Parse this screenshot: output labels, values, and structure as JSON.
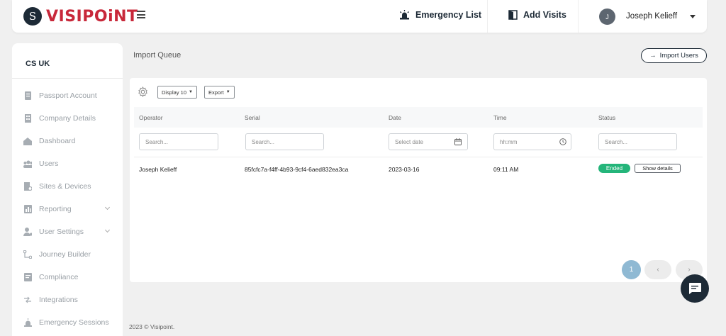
{
  "header": {
    "logo_text": "VISIPOiNT",
    "emergency_label": "Emergency List",
    "add_visits_label": "Add Visits",
    "user_initial": "J",
    "user_name": "Joseph Kelieff"
  },
  "sidebar": {
    "org": "CS UK",
    "items": [
      {
        "label": "Passport Account",
        "icon": "passport-icon"
      },
      {
        "label": "Company Details",
        "icon": "building-icon"
      },
      {
        "label": "Dashboard",
        "icon": "home-icon"
      },
      {
        "label": "Users",
        "icon": "users-icon"
      },
      {
        "label": "Sites & Devices",
        "icon": "sites-icon"
      },
      {
        "label": "Reporting",
        "icon": "reporting-icon"
      },
      {
        "label": "User Settings",
        "icon": "user-settings-icon"
      },
      {
        "label": "Journey Builder",
        "icon": "journey-icon"
      },
      {
        "label": "Compliance",
        "icon": "compliance-icon"
      },
      {
        "label": "Integrations",
        "icon": "integrations-icon"
      },
      {
        "label": "Emergency Sessions",
        "icon": "emergency-icon"
      }
    ]
  },
  "page": {
    "title": "Import Queue",
    "import_label": "Import Users"
  },
  "table": {
    "display_label": "Display 10",
    "export_label": "Export",
    "columns": [
      "Operator",
      "Serial",
      "Date",
      "Time",
      "Status"
    ],
    "filters": {
      "operator_placeholder": "Search...",
      "serial_placeholder": "Search...",
      "date_placeholder": "Select date",
      "time_placeholder": "hh:mm",
      "status_placeholder": "Search..."
    },
    "rows": [
      {
        "operator": "Joseph Kelieff",
        "serial": "85fcfc7a-f4ff-4b93-9cf4-6aed832ea3ca",
        "date": "2023-03-16",
        "time": "09:11 AM",
        "status": "Ended",
        "action": "Show details"
      }
    ],
    "pagination": {
      "current": "1",
      "prev": "‹",
      "next": "›"
    }
  },
  "footer": {
    "text": "2023 © Visipoint."
  },
  "colors": {
    "brand": "#c8283a",
    "navy": "#1d2a36",
    "status_ended": "#24b57a",
    "page_active": "#8fb9d3"
  }
}
